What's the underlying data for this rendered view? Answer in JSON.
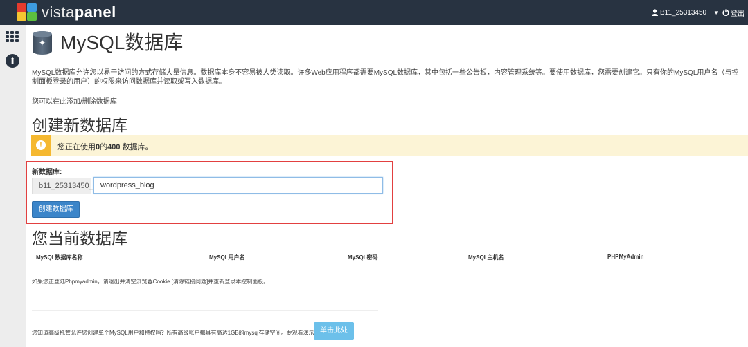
{
  "brand": {
    "name_part1": "vista",
    "name_part2": "panel"
  },
  "header": {
    "user": "B11_25313450",
    "logout": "登出"
  },
  "icons": {
    "menu": "grid-icon",
    "upload": "upload-icon",
    "user": "user-icon",
    "logout": "power-icon",
    "notice": "exclamation-icon",
    "title": "database-icon"
  },
  "page": {
    "title": "MySQL数据库",
    "intro": "MySQL数据库允许您以易于访问的方式存储大量信息。数据库本身不容易被人类读取。许多Web应用程序都需要MySQL数据库，其中包括一些公告板，内容管理系统等。要使用数据库，您需要创建它。只有你的MySQL用户名（与控制面板登录的用户）的权限来访问数据库并读取或写入数据库。",
    "manage_text": "您可以在此添加/删除数据库"
  },
  "create": {
    "heading": "创建新数据库",
    "notice_pre": "您正在使用",
    "notice_used": "0",
    "notice_mid": "的",
    "notice_total": "400",
    "notice_post": " 数据库。",
    "label": "新数据库:",
    "prefix": "b11_25313450_",
    "input_value": "wordpress_blog",
    "button": "创建数据库"
  },
  "current": {
    "heading": "您当前数据库",
    "columns": [
      "MySQL数据库名称",
      "MySQL用户名",
      "MySQL密码",
      "MySQL主机名",
      "PHPMyAdmin"
    ],
    "help_text": "如果您正登陆Phpmyadmin，请退出并清空浏览器Cookie [清除链接问题]并重新登录本控制面板。",
    "upsell_text": "您知道高级托管允许您创建单个MySQL用户和特权吗？所有高级帐户都具有高达1GB的mysql存储空间。要观看演示：",
    "upsell_button": "单击此处"
  },
  "colors": {
    "topbar": "#283341",
    "accent": "#3b85c9",
    "notice_bg": "#fcf4d6",
    "notice_icon": "#f5b830",
    "highlight_border": "#e24040",
    "cta": "#6cc0ea"
  }
}
